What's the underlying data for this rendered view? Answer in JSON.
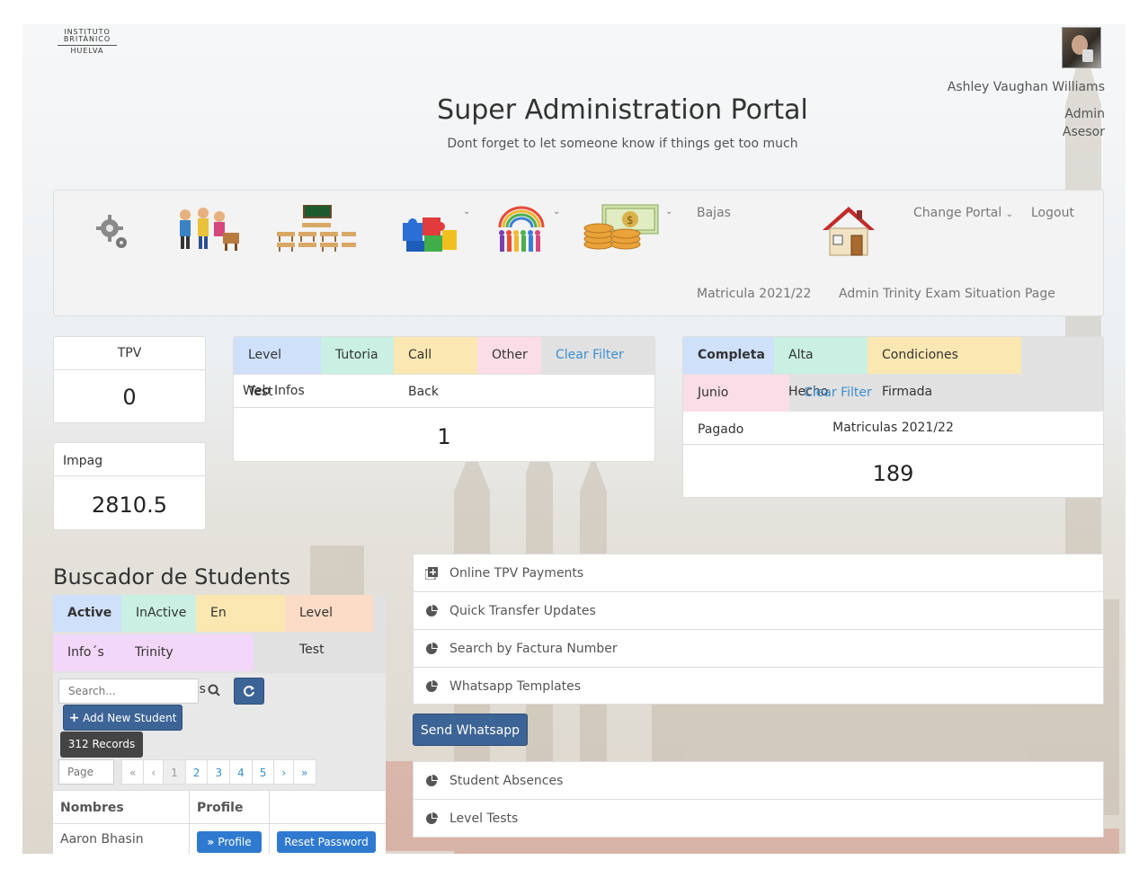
{
  "header": {
    "logo": [
      "INSTITUTO",
      "BRITÁNICO",
      "HUELVA"
    ],
    "title": "Super Administration Portal",
    "subtitle": "Dont forget to let someone know if things get too much",
    "user_name": "Ashley Vaughan Williams",
    "roles": [
      "Admin",
      "Asesor"
    ]
  },
  "navbar": {
    "links": {
      "bajas": "Bajas",
      "change_portal": "Change Portal",
      "logout": "Logout",
      "matricula": "Matricula 2021/22",
      "trinity": "Admin Trinity Exam Situation Page"
    }
  },
  "stats": {
    "tpv": {
      "label": "TPV",
      "value": "0"
    },
    "impag": {
      "label": "Impag",
      "value": "2810.5"
    }
  },
  "web_infos": {
    "tabs": [
      "Level Test",
      "Tutoria",
      "Call Back",
      "Other",
      "Clear Filter"
    ],
    "label": "Web Infos",
    "value": "1"
  },
  "matriculas": {
    "tabs": [
      "Completa",
      "Alta Hecho",
      "Condiciones Firmada",
      "Junio Pagado",
      "Clear Filter"
    ],
    "label": "Matriculas 2021/22",
    "value": "189"
  },
  "buscador": {
    "title": "Buscador de Students",
    "tabs": [
      "Active",
      "InActive",
      "En Espera",
      "Level Test",
      "Info´s",
      "Trinity Candidates"
    ],
    "search_placeholder": "Search...",
    "add_label": "Add New Student",
    "records": "312 Records",
    "page_placeholder": "Page",
    "pager": [
      "«",
      "‹",
      "1",
      "2",
      "3",
      "4",
      "5",
      "›",
      "»"
    ],
    "columns": [
      "Nombres",
      "Profile",
      ""
    ],
    "rows": [
      {
        "name": "Aaron Bhasin",
        "profile_btn": "Profile",
        "reset_btn": "Reset Password"
      }
    ]
  },
  "tools": {
    "top": [
      "Online TPV Payments",
      "Quick Transfer Updates",
      "Search by Factura Number",
      "Whatsapp Templates"
    ],
    "send_whatsapp": "Send Whatsapp",
    "bottom": [
      "Student Absences",
      "Level Tests"
    ]
  },
  "colors": {
    "tab_blue": "#cfe0fb",
    "tab_green": "#c9f0e3",
    "tab_yellow": "#fbe7b1",
    "tab_pink": "#fbdde8",
    "tab_peach": "#fcdcc6",
    "tab_purple": "#f3d7f8",
    "button_blue": "#3d6496",
    "records_badge": "#444444"
  }
}
